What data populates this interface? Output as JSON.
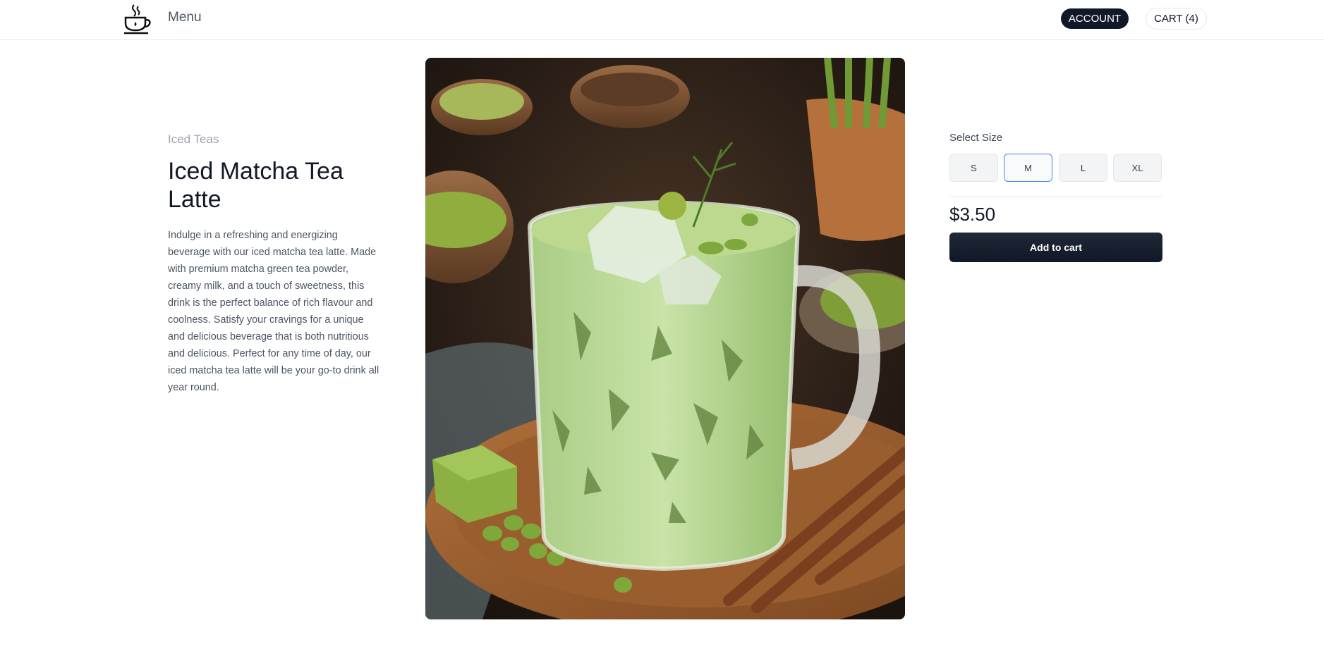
{
  "header": {
    "logo_icon": "coffee-cup-icon",
    "menu_label": "Menu",
    "account_label": "ACCOUNT",
    "cart_label": "CART (4)"
  },
  "product": {
    "category": "Iced Teas",
    "name": "Iced Matcha Tea Latte",
    "description": "Indulge in a refreshing and energizing beverage with our iced matcha tea latte. Made with premium matcha green tea powder, creamy milk, and a touch of sweetness, this drink is the perfect balance of rich flavour and coolness. Satisfy your cravings for a unique and delicious beverage that is both nutritious and delicious. Perfect for any time of day, our iced matcha tea latte will be your go-to drink all year round.",
    "price": "$3.50"
  },
  "sizes": {
    "label": "Select Size",
    "options": [
      "S",
      "M",
      "L",
      "XL"
    ],
    "selected": "M"
  },
  "actions": {
    "add_to_cart_label": "Add to cart"
  },
  "colors": {
    "primary_dark": "#111827",
    "selected_border": "#3b82f6",
    "matcha": "#b9d79a"
  }
}
